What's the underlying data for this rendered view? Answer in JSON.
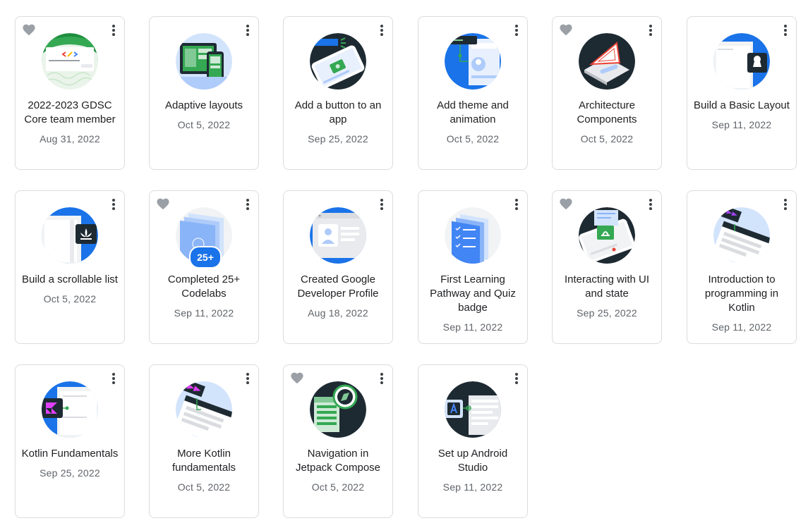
{
  "badges": [
    {
      "title": "2022-2023 GDSC Core team member",
      "date": "Aug 31, 2022",
      "liked": true,
      "icon": "gdsc-certificate-icon"
    },
    {
      "title": "Adaptive layouts",
      "date": "Oct 5, 2022",
      "liked": false,
      "icon": "adaptive-layouts-icon"
    },
    {
      "title": "Add a button to an app",
      "date": "Sep 25, 2022",
      "liked": false,
      "icon": "phone-button-icon"
    },
    {
      "title": "Add theme and animation",
      "date": "Oct 5, 2022",
      "liked": false,
      "icon": "theme-animation-icon"
    },
    {
      "title": "Architecture Components",
      "date": "Oct 5, 2022",
      "liked": true,
      "icon": "architecture-icon"
    },
    {
      "title": "Build a Basic Layout",
      "date": "Sep 11, 2022",
      "liked": false,
      "icon": "basic-layout-icon"
    },
    {
      "title": "Build a scrollable list",
      "date": "Oct 5, 2022",
      "liked": false,
      "icon": "scrollable-list-icon"
    },
    {
      "title": "Completed 25+ Codelabs",
      "date": "Sep 11, 2022",
      "liked": true,
      "icon": "codelabs-icon",
      "pill": "25+"
    },
    {
      "title": "Created Google Developer Profile",
      "date": "Aug 18, 2022",
      "liked": false,
      "icon": "profile-card-icon"
    },
    {
      "title": "First Learning Pathway and Quiz badge",
      "date": "Sep 11, 2022",
      "liked": false,
      "icon": "quiz-icon"
    },
    {
      "title": "Interacting with UI and state",
      "date": "Sep 25, 2022",
      "liked": true,
      "icon": "ui-state-icon"
    },
    {
      "title": "Introduction to programming in Kotlin",
      "date": "Sep 11, 2022",
      "liked": false,
      "icon": "kotlin-intro-icon"
    },
    {
      "title": "Kotlin Fundamentals",
      "date": "Sep 25, 2022",
      "liked": false,
      "icon": "kotlin-fundamentals-icon"
    },
    {
      "title": "More Kotlin fundamentals",
      "date": "Oct 5, 2022",
      "liked": false,
      "icon": "more-kotlin-icon"
    },
    {
      "title": "Navigation in Jetpack Compose",
      "date": "Oct 5, 2022",
      "liked": true,
      "icon": "navigation-compass-icon"
    },
    {
      "title": "Set up Android Studio",
      "date": "Sep 11, 2022",
      "liked": false,
      "icon": "android-studio-icon"
    }
  ],
  "colors": {
    "blue": "#1a73e8",
    "green": "#34a853",
    "dark": "#1e2a32",
    "heart": "#9aa0a6"
  }
}
